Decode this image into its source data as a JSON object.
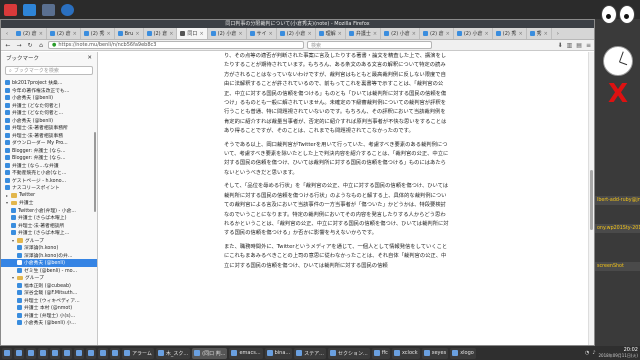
{
  "window": {
    "title": "同口判事の分限裁判について(小倉秀夫)(note) - Mozilla Firefox"
  },
  "top_panel": {
    "icons": [
      {
        "name": "bookmark-app-icon",
        "color": "#d93a3a"
      },
      {
        "name": "folder-icon",
        "color": "#2e84d6"
      },
      {
        "name": "terminal-icon",
        "color": "#5a6f8f"
      },
      {
        "name": "gnome-icon",
        "color": "#2a6fbf"
      }
    ]
  },
  "tabs": [
    {
      "label": "(2) 倉",
      "active": false
    },
    {
      "label": "(2) 倉",
      "active": false
    },
    {
      "label": "(2) 秀",
      "active": false
    },
    {
      "label": "Bru",
      "active": false
    },
    {
      "label": "(2) 倉",
      "active": false
    },
    {
      "label": "同口",
      "active": true
    },
    {
      "label": "(2) 小倉",
      "active": false
    },
    {
      "label": "サイ",
      "active": false
    },
    {
      "label": "(2) 小倉",
      "active": false
    },
    {
      "label": "理解",
      "active": false
    },
    {
      "label": "弁護士",
      "active": false
    },
    {
      "label": "(2) 小倉",
      "active": false
    },
    {
      "label": "(2) 倉",
      "active": false
    },
    {
      "label": "(2) 小倉",
      "active": false
    },
    {
      "label": "(2) 秀",
      "active": false
    },
    {
      "label": "秀",
      "active": false
    }
  ],
  "navbar": {
    "url": "https://note.mu/benli/n/ncb56fa9eb8c3",
    "search_placeholder": "検索"
  },
  "sidebar": {
    "title": "ブックマーク",
    "search_placeholder": "ブックマークを検索",
    "items": [
      {
        "label": "bk2017project 扶桑...",
        "kind": "bookmark",
        "depth": 0
      },
      {
        "label": "今年の著作権法改正でも…",
        "kind": "bookmark",
        "depth": 0
      },
      {
        "label": "小倉秀夫 (@benli)",
        "kind": "bookmark",
        "depth": 0
      },
      {
        "label": "弁護士 (どなた何者と)",
        "kind": "bookmark",
        "depth": 0
      },
      {
        "label": "弁護士 (どなた何者と…",
        "kind": "bookmark",
        "depth": 0
      },
      {
        "label": "小倉秀夫 (@benli)",
        "kind": "bookmark",
        "depth": 0
      },
      {
        "label": "弁理士·法·著者相談事務所",
        "kind": "bookmark",
        "depth": 0
      },
      {
        "label": "弁理士·法·著者相談事務",
        "kind": "bookmark",
        "depth": 0
      },
      {
        "label": "ダウンローダー My Pro...",
        "kind": "bookmark",
        "depth": 0
      },
      {
        "label": "Blogger: 弁護士 (なら...",
        "kind": "bookmark",
        "depth": 0
      },
      {
        "label": "Blogger: 弁護士 (なら...",
        "kind": "bookmark",
        "depth": 0
      },
      {
        "label": "弁護士 (なら…な弁護",
        "kind": "bookmark",
        "depth": 0
      },
      {
        "label": "不動産競売と小倉(なと...",
        "kind": "bookmark",
        "depth": 0
      },
      {
        "label": "ゲストページ - h.kono...",
        "kind": "bookmark",
        "depth": 0
      },
      {
        "label": "ナスコリースポイント",
        "kind": "bookmark",
        "depth": 0
      },
      {
        "label": "Twitter",
        "kind": "folder",
        "depth": 0,
        "open": false
      },
      {
        "label": "弁護士",
        "kind": "folder",
        "depth": 0,
        "open": true
      },
      {
        "label": "Twitter小倉(弁理) - 小倉...",
        "kind": "bookmark",
        "depth": 1
      },
      {
        "label": "弁護士 (さらば木曜上)",
        "kind": "bookmark",
        "depth": 1
      },
      {
        "label": "弁理士·法·著者相談所",
        "kind": "bookmark",
        "depth": 1
      },
      {
        "label": "弁護士 (さらば木曜上…",
        "kind": "bookmark",
        "depth": 1
      },
      {
        "label": "グループ",
        "kind": "folder",
        "depth": 1,
        "open": true
      },
      {
        "label": "深澤論(h.kono)",
        "kind": "bookmark",
        "depth": 2
      },
      {
        "label": "深澤論(h.kono)の弁…",
        "kind": "bookmark",
        "depth": 2
      },
      {
        "label": "小倉秀夫 (@benli)",
        "kind": "bookmark",
        "depth": 2,
        "selected": true
      },
      {
        "label": "ゼミ生 (@benli) - mo...",
        "kind": "bookmark",
        "depth": 2
      },
      {
        "label": "グループ",
        "kind": "folder",
        "depth": 1,
        "open": true
      },
      {
        "label": "福本正則 (@cubeab)",
        "kind": "bookmark",
        "depth": 2
      },
      {
        "label": "深谷全哉 (@F.Mitsuth...",
        "kind": "bookmark",
        "depth": 2
      },
      {
        "label": "弁理士 (ウィキペディア...",
        "kind": "bookmark",
        "depth": 2
      },
      {
        "label": "弁護士 本村 (@nmot)",
        "kind": "bookmark",
        "depth": 2
      },
      {
        "label": "弁護士 (弁理士) 小(s)...",
        "kind": "bookmark",
        "depth": 2
      },
      {
        "label": "小倉秀夫 (@benli) 小...",
        "kind": "bookmark",
        "depth": 2
      }
    ]
  },
  "article": {
    "paragraphs": [
      "り、その点等の適否が判断された事案に言及したりする著書・論文を精査した上で、講演をしたりすることが期待されています。もちろん、ある条文のある文言の解釈について特定の読み方がされることはなっていないわけですが、裁判官はもともと最高裁判例に反しない限度で自由に法解釈することが許されているので、前もってこれを裏書等で示すことは、「裁判官の公正、中立に対する国民の信頼を傷つける」ものとも「ひいては裁判所に対する国民の信頼を傷つけ」るものとも一般に解されていません。未確定の下級審裁判例についての裁判官が評釈を行うことも普通、特に問題視されていないのです。もちろん、その評釈において当該裁判例を肯定的に紹介すれば裁量当事者が、否定的に紹介すれば原判当事者が不快な思いをすることはあり得ることですが、そのことは、これまでも問題視されてこなかったのです。",
      "そうである以上、岡口裁判官がTwitterを用いて行っていた、考慮すべき要素のある裁判例について、考慮すべき要素を除いたとした上で判決内容を紹介することは、「裁判官の公正、中立に対する国民の信頼を傷つけ、ひいては裁判所に対する国民の信頼を傷つける」ものにはあたらないというべきだと思います。",
      "そして、「品位を辱める行状」を「裁判官の公正、中立に対する国民の信頼を傷つけ、ひいては裁判所に対する国民の信頼を傷つける行状」のようなものと解する上、具体的な裁判例についての裁判官による言及において当該事件の一方当事者が「傷ついた」かどうかは、特段要検討なのでいうことになります。特定の裁判例においてその内容を発言したりする人からどう思われるかということは、「裁判官の公正、中立に対する国民の信頼を傷つけ、ひいては裁判所に対する国民の信頼を傷つける」か否かに影響を与えないからです。",
      "また、職務時間外に、Twitterというメディアを通じて、一個人として情報発信をしていくことにこれもまあみるべきことの上司の意思に従わなかったことは、それ自体「裁判官の公正、中立に対する国民の信頼を傷つけ、ひいては裁判所に対する国民の信頼"
    ]
  },
  "desktop": {
    "notes": [
      "lbert-add-ruby@jnlg@...",
      "ony.wp201Sty-2017?",
      "screenShot"
    ]
  },
  "taskbar": {
    "buttons": [
      {
        "label": "",
        "icon": "app-grid-icon"
      },
      {
        "label": "",
        "icon": "files-icon"
      },
      {
        "label": "",
        "icon": "terminal-icon"
      },
      {
        "label": "",
        "icon": "browser-icon"
      },
      {
        "label": "",
        "icon": "mail-icon"
      },
      {
        "label": "",
        "icon": "chat-icon"
      },
      {
        "label": "",
        "icon": "editor-icon"
      },
      {
        "label": "",
        "icon": "music-icon"
      },
      {
        "label": "",
        "icon": "video-icon"
      },
      {
        "label": "",
        "icon": "settings-icon"
      },
      {
        "label": "アラーム",
        "icon": "alarm-icon"
      },
      {
        "label": "木_スク...",
        "icon": "doc-icon"
      },
      {
        "label": "(同口 判...",
        "icon": "firefox-icon",
        "active": true
      },
      {
        "label": "emacs...",
        "icon": "emacs-icon"
      },
      {
        "label": "bina...",
        "icon": "term-icon"
      },
      {
        "label": "ステア...",
        "icon": "app-icon"
      },
      {
        "label": "セクション...",
        "icon": "app-icon"
      },
      {
        "label": "ffc",
        "icon": "app-icon"
      },
      {
        "label": "xclock",
        "icon": "clock-icon"
      },
      {
        "label": "xeyes",
        "icon": "eyes-icon"
      },
      {
        "label": "xlogo",
        "icon": "logo-icon"
      }
    ],
    "time": "20:02",
    "date": "2018年09月11日(火)"
  }
}
